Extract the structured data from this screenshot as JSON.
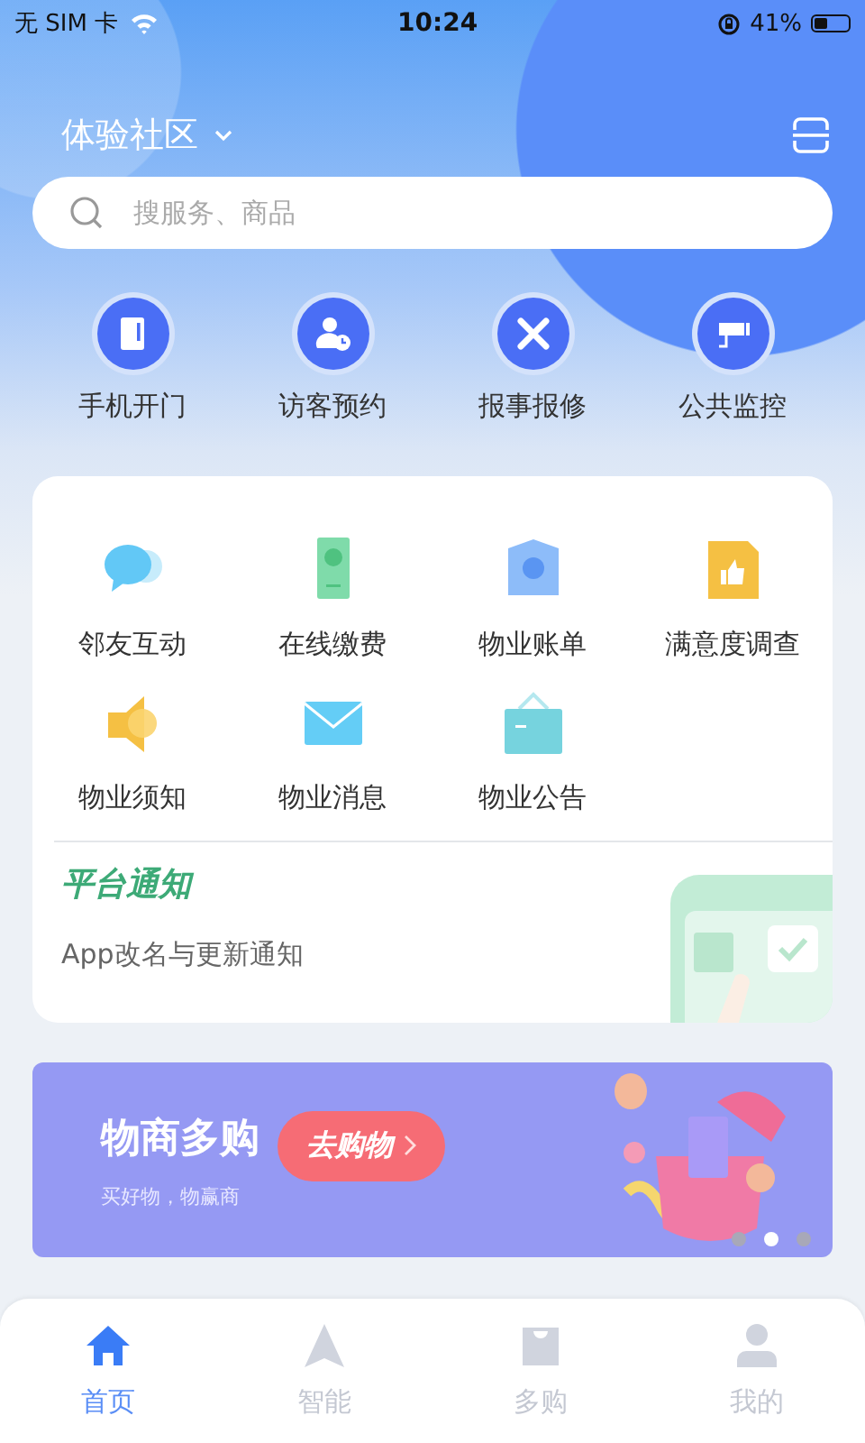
{
  "status_bar": {
    "carrier": "无 SIM 卡",
    "time": "10:24",
    "battery": "41%"
  },
  "header": {
    "community": "体验社区"
  },
  "search": {
    "placeholder": "搜服务、商品"
  },
  "quick_actions": [
    {
      "label": "手机开门",
      "kind": "door"
    },
    {
      "label": "访客预约",
      "kind": "visitor"
    },
    {
      "label": "报事报修",
      "kind": "repair"
    },
    {
      "label": "公共监控",
      "kind": "camera"
    }
  ],
  "services": [
    {
      "label": "邻友互动",
      "kind": "chat"
    },
    {
      "label": "在线缴费",
      "kind": "pay"
    },
    {
      "label": "物业账单",
      "kind": "bill"
    },
    {
      "label": "满意度调查",
      "kind": "survey"
    },
    {
      "label": "物业须知",
      "kind": "speaker"
    },
    {
      "label": "物业消息",
      "kind": "mail"
    },
    {
      "label": "物业公告",
      "kind": "notice"
    }
  ],
  "notice": {
    "title": "平台通知",
    "text": "App改名与更新通知"
  },
  "banner": {
    "title": "物商多购",
    "subtitle": "买好物，物赢商",
    "button": "去购物",
    "dots": [
      {
        "selected": false
      },
      {
        "selected": true
      },
      {
        "selected": false
      }
    ]
  },
  "tab_bar": [
    {
      "label": "首页",
      "kind": "home",
      "selected": true
    },
    {
      "label": "智能",
      "kind": "smart",
      "selected": false
    },
    {
      "label": "多购",
      "kind": "shop",
      "selected": false
    },
    {
      "label": "我的",
      "kind": "me",
      "selected": false
    }
  ]
}
